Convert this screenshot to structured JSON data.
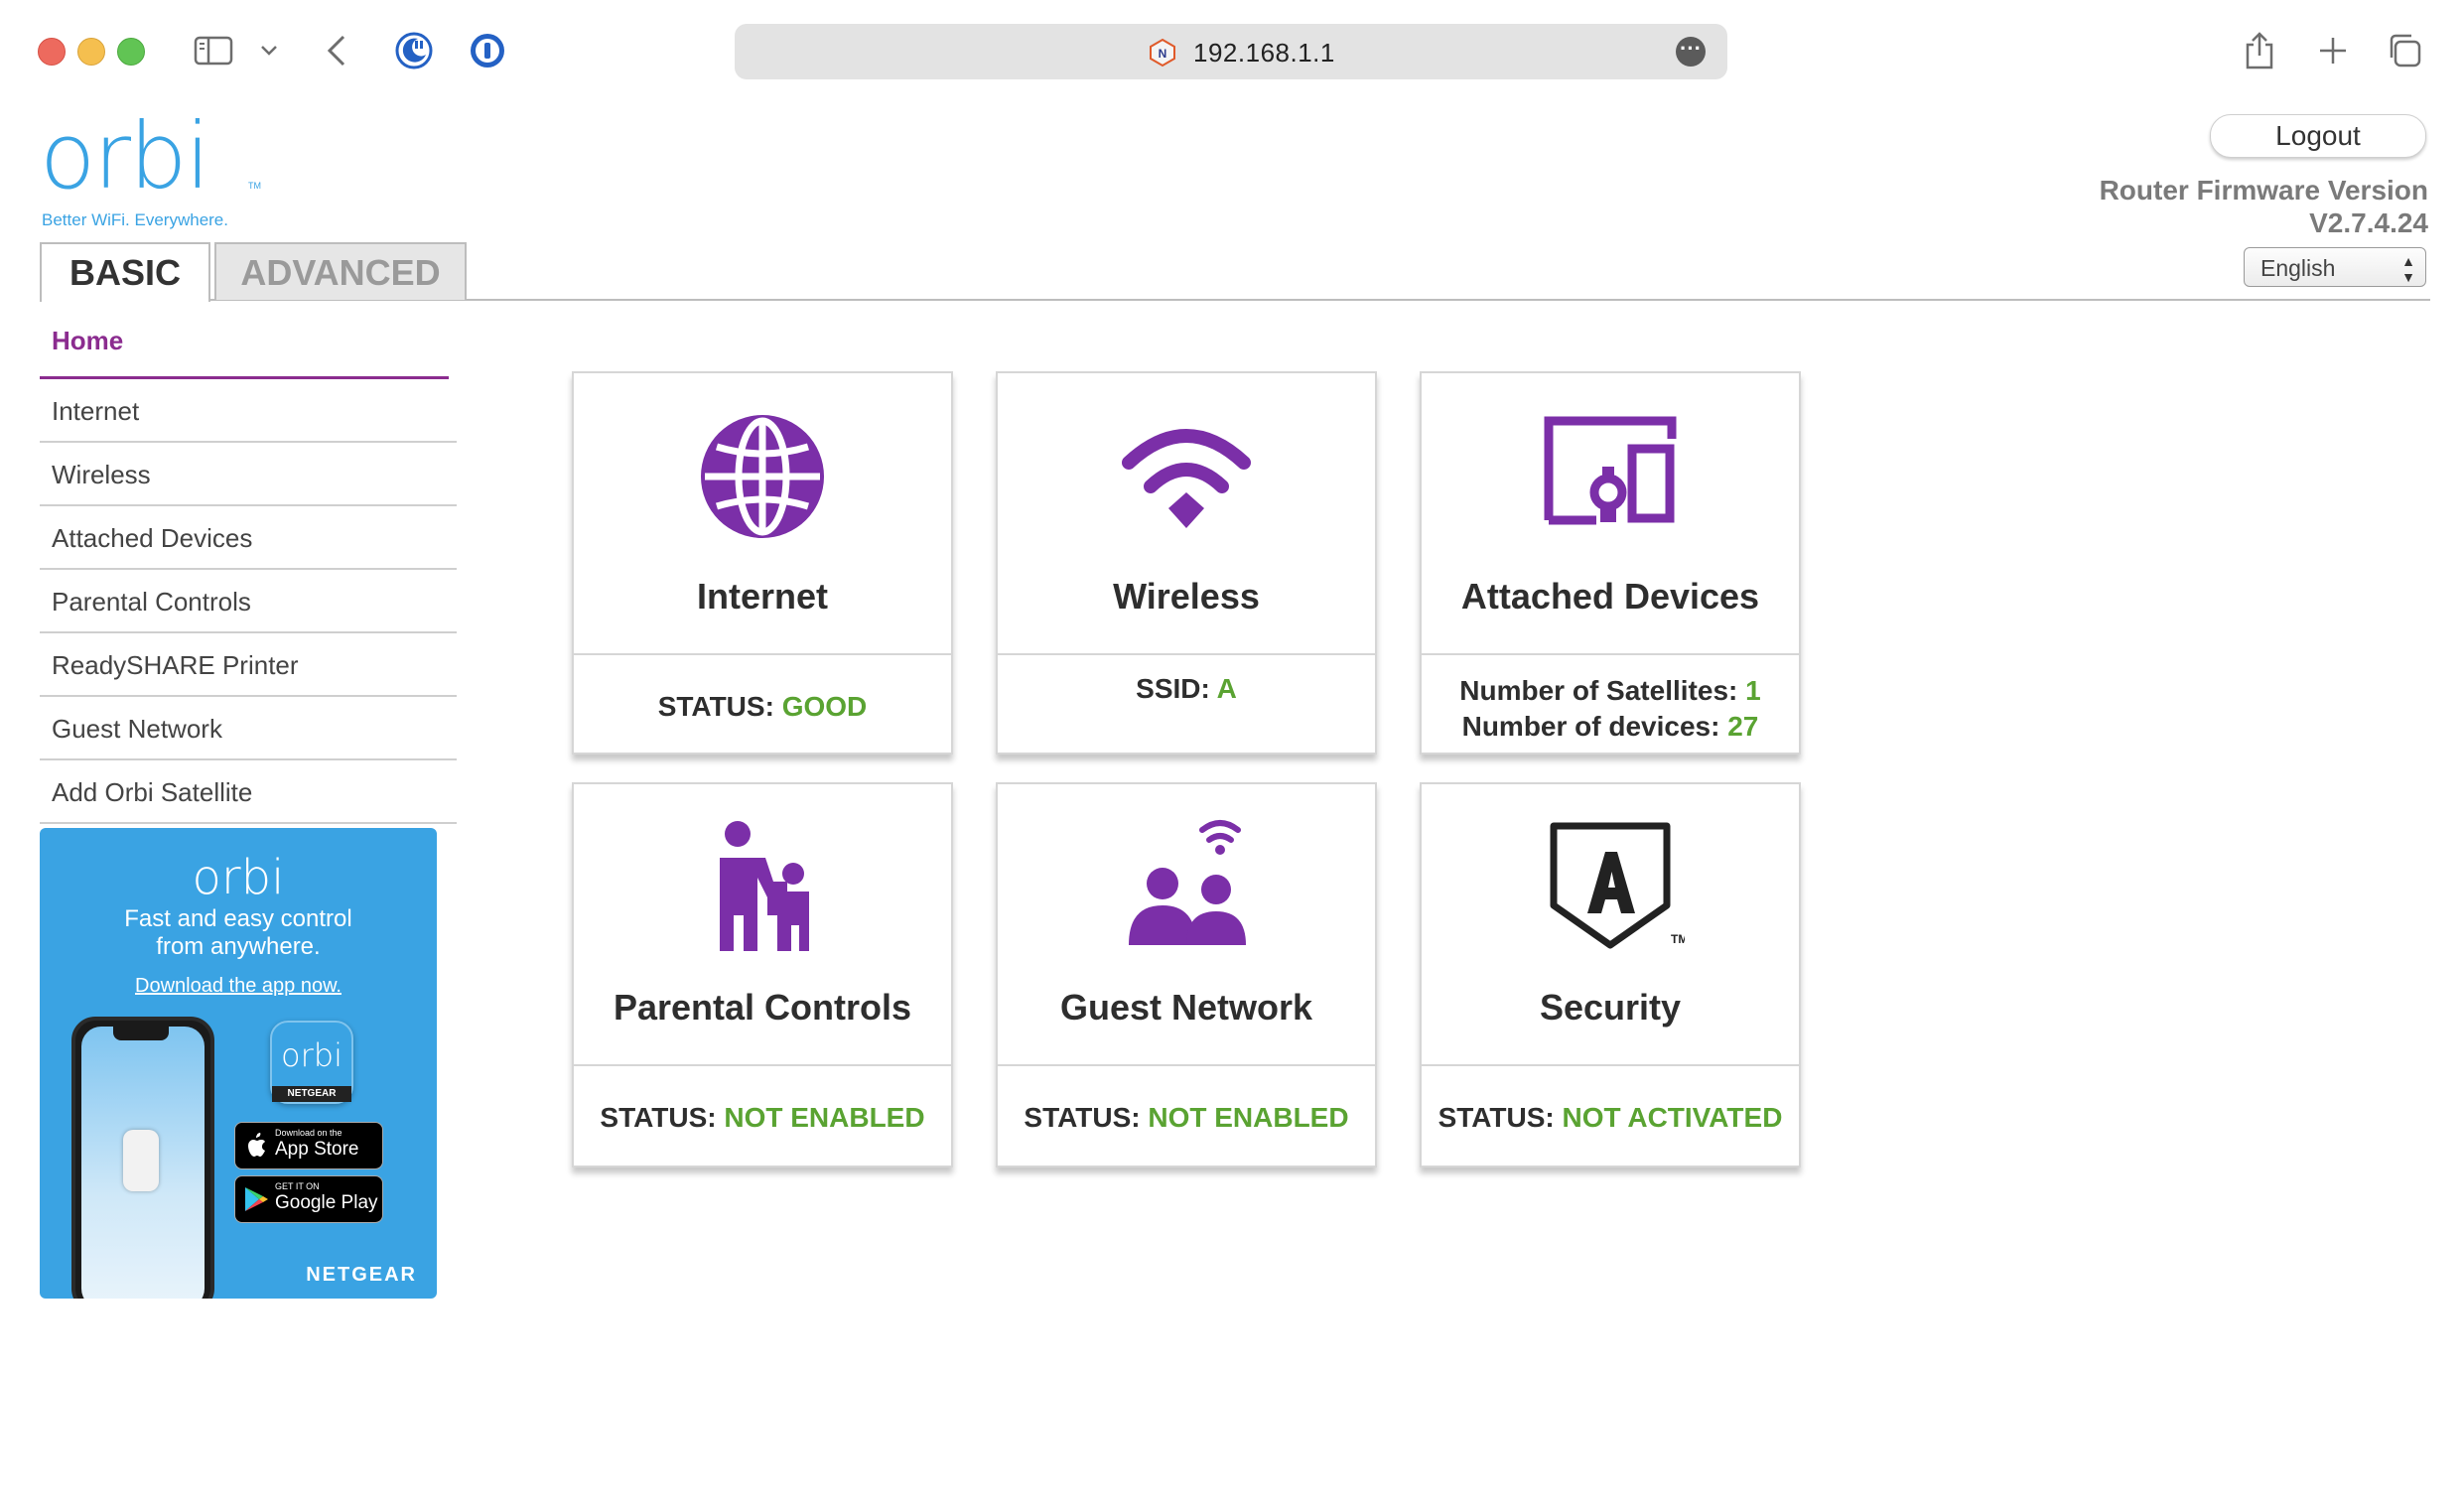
{
  "browser": {
    "url": "192.168.1.1"
  },
  "header": {
    "logo_text": "orbi",
    "logo_tm": "TM",
    "tagline": "Better WiFi. Everywhere.",
    "logout_label": "Logout",
    "firmware_label": "Router Firmware Version",
    "firmware_version": "V2.7.4.24",
    "language": "English"
  },
  "tabs": {
    "basic": "BASIC",
    "advanced": "ADVANCED"
  },
  "sidebar": {
    "items": [
      {
        "label": "Home"
      },
      {
        "label": "Internet"
      },
      {
        "label": "Wireless"
      },
      {
        "label": "Attached Devices"
      },
      {
        "label": "Parental Controls"
      },
      {
        "label": "ReadySHARE Printer"
      },
      {
        "label": "Guest Network"
      },
      {
        "label": "Add Orbi Satellite"
      }
    ]
  },
  "promo": {
    "logo": "orbi",
    "line1": "Fast and easy control",
    "line2": "from anywhere.",
    "link": "Download the app now.",
    "app_icon_text": "orbi",
    "app_icon_band": "NETGEAR",
    "appstore_small": "Download on the",
    "appstore_big": "App Store",
    "googleplay_small": "GET IT ON",
    "googleplay_big": "Google Play",
    "brand": "NETGEAR"
  },
  "cards": {
    "internet": {
      "title": "Internet",
      "status_label": "STATUS:",
      "status_value": "GOOD"
    },
    "wireless": {
      "title": "Wireless",
      "ssid_label": "SSID:",
      "ssid_value": "A"
    },
    "attached": {
      "title": "Attached Devices",
      "sat_label": "Number of Satellites:",
      "sat_value": "1",
      "dev_label": "Number of devices:",
      "dev_value": "27"
    },
    "parental": {
      "title": "Parental Controls",
      "status_label": "STATUS:",
      "status_value": "NOT ENABLED"
    },
    "guest": {
      "title": "Guest Network",
      "status_label": "STATUS:",
      "status_value": "NOT ENABLED"
    },
    "security": {
      "title": "Security",
      "status_label": "STATUS:",
      "status_value": "NOT ACTIVATED"
    }
  },
  "colors": {
    "accent_purple": "#8b2c8f",
    "icon_purple": "#7b2fa8",
    "status_green": "#5aa332",
    "brand_blue": "#3aa3e3"
  }
}
